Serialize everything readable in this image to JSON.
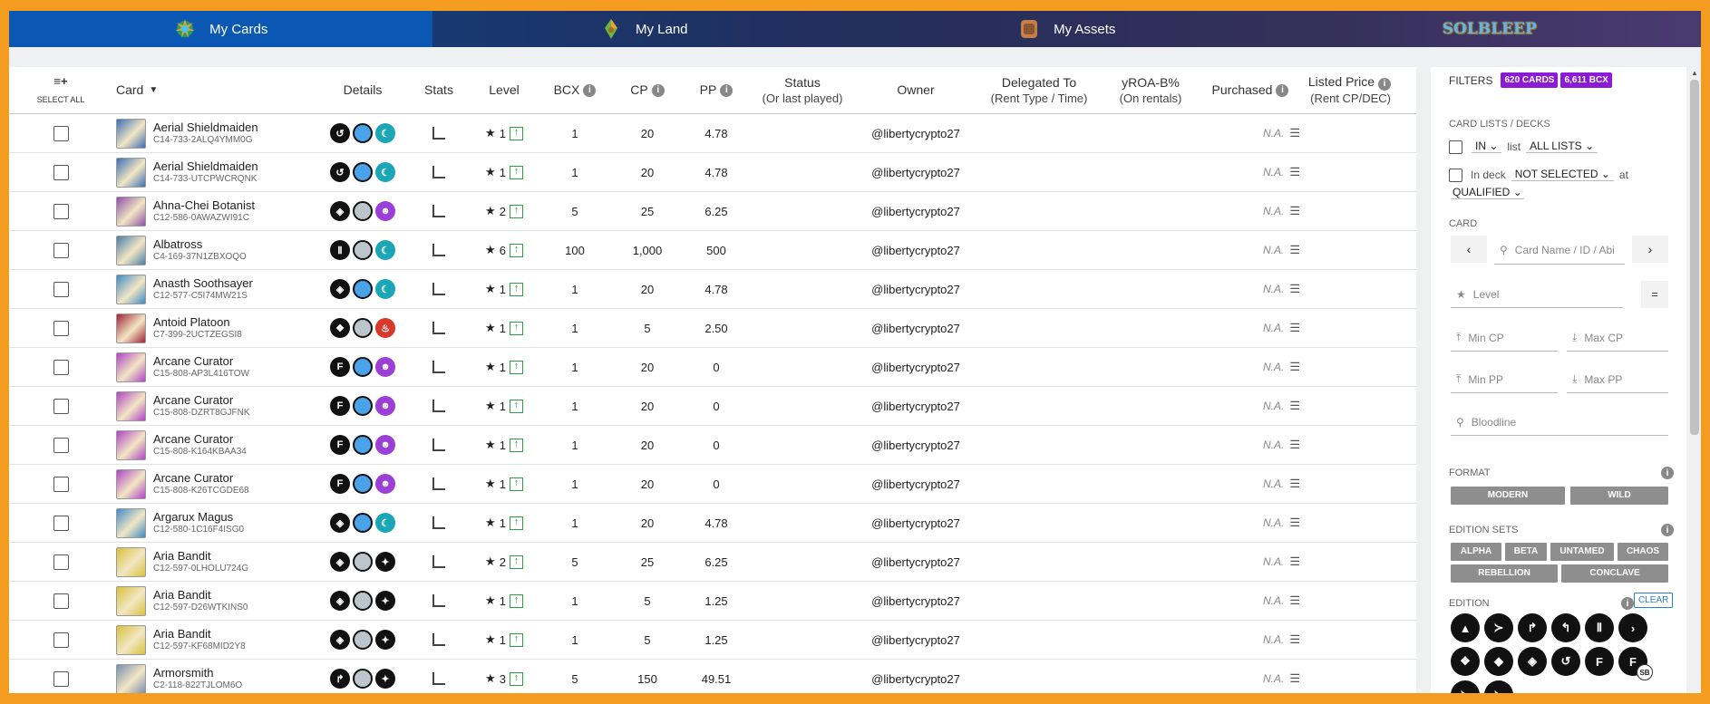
{
  "nav": {
    "tabs": [
      {
        "label": "My Cards",
        "icon": "cards-icon"
      },
      {
        "label": "My Land",
        "icon": "land-icon"
      },
      {
        "label": "My Assets",
        "icon": "assets-icon"
      }
    ],
    "logo": "SOLBLEEP"
  },
  "table": {
    "select_all": "SELECT ALL",
    "headers": {
      "card": "Card",
      "details": "Details",
      "stats": "Stats",
      "level": "Level",
      "bcx": "BCX",
      "cp": "CP",
      "pp": "PP",
      "status": "Status",
      "status_sub": "(Or last played)",
      "owner": "Owner",
      "delegated": "Delegated To",
      "delegated_sub": "(Rent Type / Time)",
      "yroa": "yROA-B%",
      "yroa_sub": "(On rentals)",
      "purchased": "Purchased",
      "listed": "Listed Price",
      "listed_sub": "(Rent CP/DEC)"
    },
    "rows": [
      {
        "name": "Aerial Shieldmaiden",
        "id": "C14-733-2ALQ4YMM0G",
        "ed": "↺",
        "rar": "#4aa3e8",
        "el": "#1aa6b7",
        "elg": "☾",
        "lvl": "1",
        "bcx": "1",
        "cp": "20",
        "pp": "4.78",
        "owner": "@libertycrypto27",
        "purchased": "N.A.",
        "thumb": "#3d6fb5"
      },
      {
        "name": "Aerial Shieldmaiden",
        "id": "C14-733-UTCPWCRQNK",
        "ed": "↺",
        "rar": "#4aa3e8",
        "el": "#1aa6b7",
        "elg": "☾",
        "lvl": "1",
        "bcx": "1",
        "cp": "20",
        "pp": "4.78",
        "owner": "@libertycrypto27",
        "purchased": "N.A.",
        "thumb": "#3d6fb5"
      },
      {
        "name": "Ahna-Chei Botanist",
        "id": "C12-586-0AWAZWI91C",
        "ed": "◈",
        "rar": "#bcc4cc",
        "el": "#9b3fd6",
        "elg": "☻",
        "lvl": "2",
        "bcx": "5",
        "cp": "25",
        "pp": "6.25",
        "owner": "@libertycrypto27",
        "purchased": "N.A.",
        "thumb": "#8d4fa8"
      },
      {
        "name": "Albatross",
        "id": "C4-169-37N1ZBXOQO",
        "ed": "Ⅱ",
        "rar": "#bcc4cc",
        "el": "#1aa6b7",
        "elg": "☾",
        "lvl": "6",
        "bcx": "100",
        "cp": "1,000",
        "pp": "500",
        "owner": "@libertycrypto27",
        "purchased": "N.A.",
        "thumb": "#4a7fa8"
      },
      {
        "name": "Anasth Soothsayer",
        "id": "C12-577-C5I74MW21S",
        "ed": "◈",
        "rar": "#4aa3e8",
        "el": "#1aa6b7",
        "elg": "☾",
        "lvl": "1",
        "bcx": "1",
        "cp": "20",
        "pp": "4.78",
        "owner": "@libertycrypto27",
        "purchased": "N.A.",
        "thumb": "#3f8bc6"
      },
      {
        "name": "Antoid Platoon",
        "id": "C7-399-2UCTZEGSI8",
        "ed": "❖",
        "rar": "#bcc4cc",
        "el": "#d9382b",
        "elg": "♨",
        "lvl": "1",
        "bcx": "1",
        "cp": "5",
        "pp": "2.50",
        "owner": "@libertycrypto27",
        "purchased": "N.A.",
        "thumb": "#a12236"
      },
      {
        "name": "Arcane Curator",
        "id": "C15-808-AP3L416TOW",
        "ed": "F",
        "rar": "#4aa3e8",
        "el": "#9b3fd6",
        "elg": "☻",
        "lvl": "1",
        "bcx": "1",
        "cp": "20",
        "pp": "0",
        "owner": "@libertycrypto27",
        "purchased": "N.A.",
        "thumb": "#b044c8"
      },
      {
        "name": "Arcane Curator",
        "id": "C15-808-DZRT8GJFNK",
        "ed": "F",
        "rar": "#4aa3e8",
        "el": "#9b3fd6",
        "elg": "☻",
        "lvl": "1",
        "bcx": "1",
        "cp": "20",
        "pp": "0",
        "owner": "@libertycrypto27",
        "purchased": "N.A.",
        "thumb": "#b044c8"
      },
      {
        "name": "Arcane Curator",
        "id": "C15-808-K164KBAA34",
        "ed": "F",
        "rar": "#4aa3e8",
        "el": "#9b3fd6",
        "elg": "☻",
        "lvl": "1",
        "bcx": "1",
        "cp": "20",
        "pp": "0",
        "owner": "@libertycrypto27",
        "purchased": "N.A.",
        "thumb": "#b044c8"
      },
      {
        "name": "Arcane Curator",
        "id": "C15-808-K26TCGDE68",
        "ed": "F",
        "rar": "#4aa3e8",
        "el": "#9b3fd6",
        "elg": "☻",
        "lvl": "1",
        "bcx": "1",
        "cp": "20",
        "pp": "0",
        "owner": "@libertycrypto27",
        "purchased": "N.A.",
        "thumb": "#b044c8"
      },
      {
        "name": "Argarux Magus",
        "id": "C12-580-1C16F4ISG0",
        "ed": "◈",
        "rar": "#4aa3e8",
        "el": "#1aa6b7",
        "elg": "☾",
        "lvl": "1",
        "bcx": "1",
        "cp": "20",
        "pp": "4.78",
        "owner": "@libertycrypto27",
        "purchased": "N.A.",
        "thumb": "#3f8bc6"
      },
      {
        "name": "Aria Bandit",
        "id": "C12-597-0LHOLU724G",
        "ed": "◈",
        "rar": "#bcc4cc",
        "el": "#111111",
        "elg": "✦",
        "lvl": "2",
        "bcx": "5",
        "cp": "25",
        "pp": "6.25",
        "owner": "@libertycrypto27",
        "purchased": "N.A.",
        "thumb": "#d8c23a"
      },
      {
        "name": "Aria Bandit",
        "id": "C12-597-D26WTKINS0",
        "ed": "◈",
        "rar": "#bcc4cc",
        "el": "#111111",
        "elg": "✦",
        "lvl": "1",
        "bcx": "1",
        "cp": "5",
        "pp": "1.25",
        "owner": "@libertycrypto27",
        "purchased": "N.A.",
        "thumb": "#d8c23a"
      },
      {
        "name": "Aria Bandit",
        "id": "C12-597-KF68MID2Y8",
        "ed": "◈",
        "rar": "#bcc4cc",
        "el": "#111111",
        "elg": "✦",
        "lvl": "1",
        "bcx": "1",
        "cp": "5",
        "pp": "1.25",
        "owner": "@libertycrypto27",
        "purchased": "N.A.",
        "thumb": "#d8c23a"
      },
      {
        "name": "Armorsmith",
        "id": "C2-118-822TJLOM6O",
        "ed": "↱",
        "rar": "#bcc4cc",
        "el": "#111111",
        "elg": "✦",
        "lvl": "3",
        "bcx": "5",
        "cp": "150",
        "pp": "49.51",
        "owner": "@libertycrypto27",
        "purchased": "N.A.",
        "thumb": "#7a8fb0"
      }
    ]
  },
  "filters": {
    "title": "FILTERS",
    "badge_cards": "620 CARDS",
    "badge_bcx": "6,611 BCX",
    "lists_title": "CARD LISTS / DECKS",
    "in_select": "IN",
    "list_word": "list",
    "all_lists": "ALL LISTS",
    "in_deck": "In deck",
    "not_selected": "NOT SELECTED",
    "at_word": "at",
    "qualified": "QUALIFIED",
    "card_title": "CARD",
    "card_placeholder": "Card Name / ID / Abi",
    "level_placeholder": "Level",
    "eq": "=",
    "min_cp": "Min CP",
    "max_cp": "Max CP",
    "min_pp": "Min PP",
    "max_pp": "Max PP",
    "bloodline": "Bloodline",
    "format_title": "FORMAT",
    "modern": "MODERN",
    "wild": "WILD",
    "edition_sets_title": "EDITION SETS",
    "alpha": "ALPHA",
    "beta": "BETA",
    "untamed": "UNTAMED",
    "chaos": "CHAOS",
    "rebellion": "REBELLION",
    "conclave": "CONCLAVE",
    "edition_title": "EDITION",
    "clear": "CLEAR",
    "sb_badge": "SB"
  }
}
